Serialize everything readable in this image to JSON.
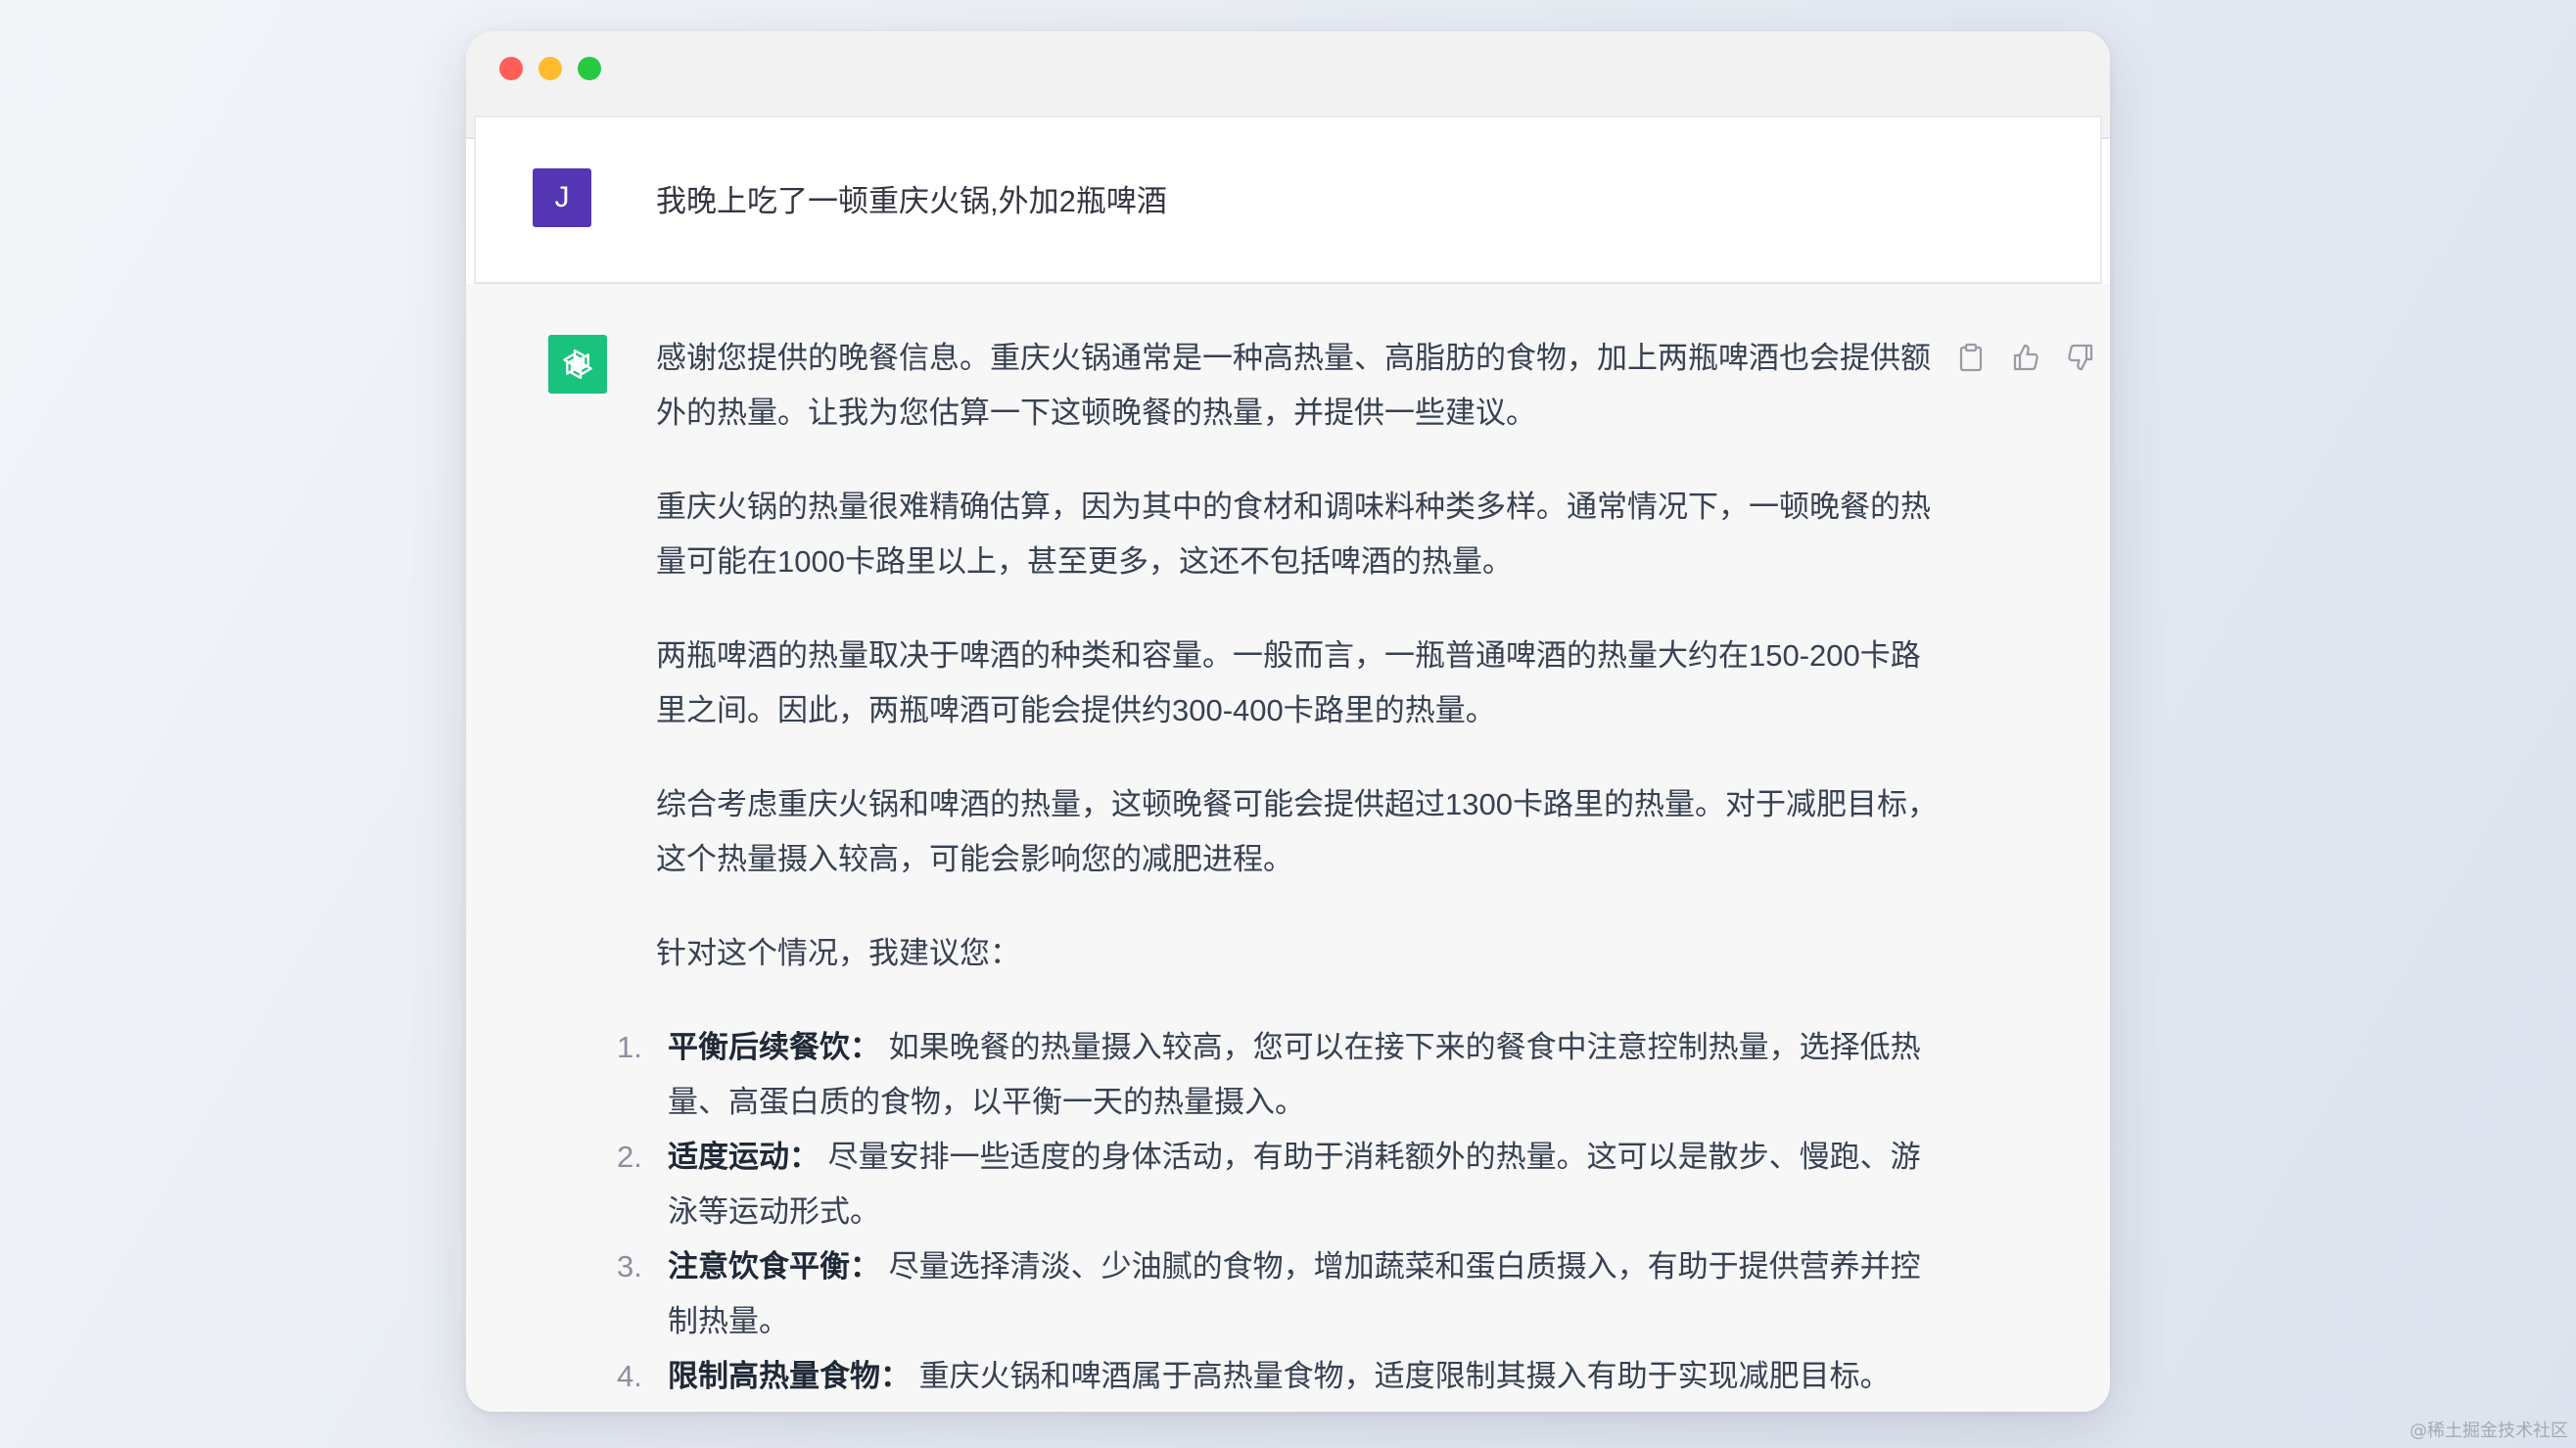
{
  "user_message": {
    "avatar_initial": "J",
    "text": "我晚上吃了一顿重庆火锅,外加2瓶啤酒"
  },
  "assistant_message": {
    "paragraphs": [
      "感谢您提供的晚餐信息。重庆火锅通常是一种高热量、高脂肪的食物，加上两瓶啤酒也会提供额外的热量。让我为您估算一下这顿晚餐的热量，并提供一些建议。",
      "重庆火锅的热量很难精确估算，因为其中的食材和调味料种类多样。通常情况下，一顿晚餐的热量可能在1000卡路里以上，甚至更多，这还不包括啤酒的热量。",
      "两瓶啤酒的热量取决于啤酒的种类和容量。一般而言，一瓶普通啤酒的热量大约在150-200卡路里之间。因此，两瓶啤酒可能会提供约300-400卡路里的热量。",
      "综合考虑重庆火锅和啤酒的热量，这顿晚餐可能会提供超过1300卡路里的热量。对于减肥目标，这个热量摄入较高，可能会影响您的减肥进程。",
      "针对这个情况，我建议您："
    ],
    "list": [
      {
        "num": "1.",
        "title": "平衡后续餐饮：",
        "body": "如果晚餐的热量摄入较高，您可以在接下来的餐食中注意控制热量，选择低热量、高蛋白质的食物，以平衡一天的热量摄入。"
      },
      {
        "num": "2.",
        "title": "适度运动：",
        "body": "尽量安排一些适度的身体活动，有助于消耗额外的热量。这可以是散步、慢跑、游泳等运动形式。"
      },
      {
        "num": "3.",
        "title": "注意饮食平衡：",
        "body": "尽量选择清淡、少油腻的食物，增加蔬菜和蛋白质摄入，有助于提供营养并控制热量。"
      },
      {
        "num": "4.",
        "title": "限制高热量食物：",
        "body": "重庆火锅和啤酒属于高热量食物，适度限制其摄入有助于实现减肥目标。"
      }
    ]
  },
  "actions": {
    "copy_icon": "clipboard-icon",
    "like_icon": "thumbs-up-icon",
    "dislike_icon": "thumbs-down-icon"
  },
  "colors": {
    "user_avatar": "#5436b4",
    "assistant_avatar": "#19c37d",
    "close": "#ff5f57",
    "minimize": "#febc2e",
    "maximize": "#28c840"
  },
  "watermark": "@稀土掘金技术社区"
}
